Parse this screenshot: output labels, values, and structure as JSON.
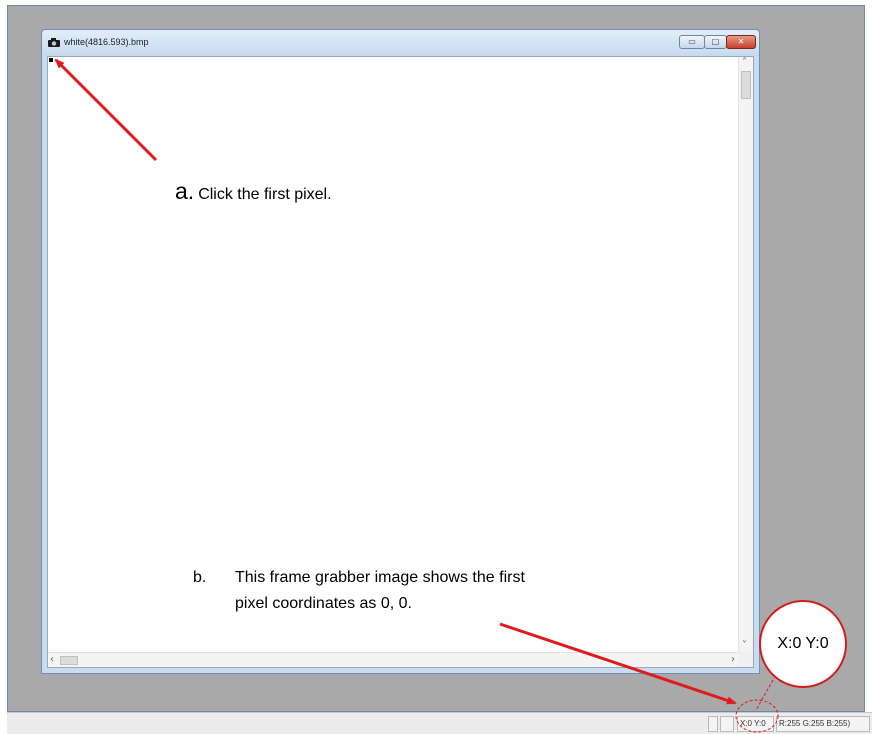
{
  "window": {
    "title": "white(4816.593).bmp",
    "minimize_glyph": "▭",
    "maximize_glyph": "□",
    "close_glyph": "✕"
  },
  "scrollbar": {
    "up_arrow": "˄",
    "down_arrow": "˅",
    "left_arrow": "‹",
    "right_arrow": "›"
  },
  "annotations": {
    "a_letter": "a.",
    "a_text": "Click the first pixel.",
    "b_letter": "b.",
    "b_line1": "This frame grabber image shows the first",
    "b_line2": "pixel coordinates as 0, 0."
  },
  "callout": {
    "text": "X:0 Y:0"
  },
  "statusbar": {
    "coords": "X:0 Y:0",
    "rgb": "R:255 G:255 B:255)"
  },
  "colors": {
    "annotation_red": "#e01b1b",
    "background_gray": "#a9a9a9"
  }
}
